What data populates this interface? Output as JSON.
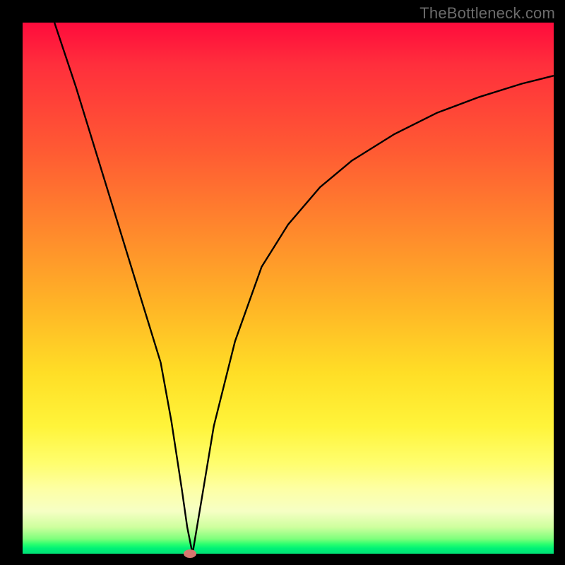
{
  "watermark": "TheBottleneck.com",
  "colors": {
    "frame": "#000000",
    "curve": "#000000",
    "marker": "#d6766f"
  },
  "chart_data": {
    "type": "line",
    "title": "",
    "xlabel": "",
    "ylabel": "",
    "xlim": [
      0,
      100
    ],
    "ylim": [
      0,
      100
    ],
    "grid": false,
    "legend": false,
    "background_gradient": [
      "#ff0b3c",
      "#ff8b2c",
      "#ffde26",
      "#fdffa6",
      "#00e176"
    ],
    "series": [
      {
        "name": "curve",
        "x": [
          6,
          10,
          14,
          18,
          22,
          26,
          28,
          30,
          31,
          32,
          34,
          36,
          40,
          45,
          50,
          56,
          62,
          70,
          78,
          86,
          94,
          100
        ],
        "values": [
          100,
          88,
          75,
          62,
          49,
          36,
          25,
          12,
          5,
          0,
          12,
          24,
          40,
          54,
          62,
          69,
          74,
          79,
          83,
          86,
          88.5,
          90
        ]
      }
    ],
    "minimum_marker": {
      "x": 31.5,
      "y": 0
    }
  }
}
